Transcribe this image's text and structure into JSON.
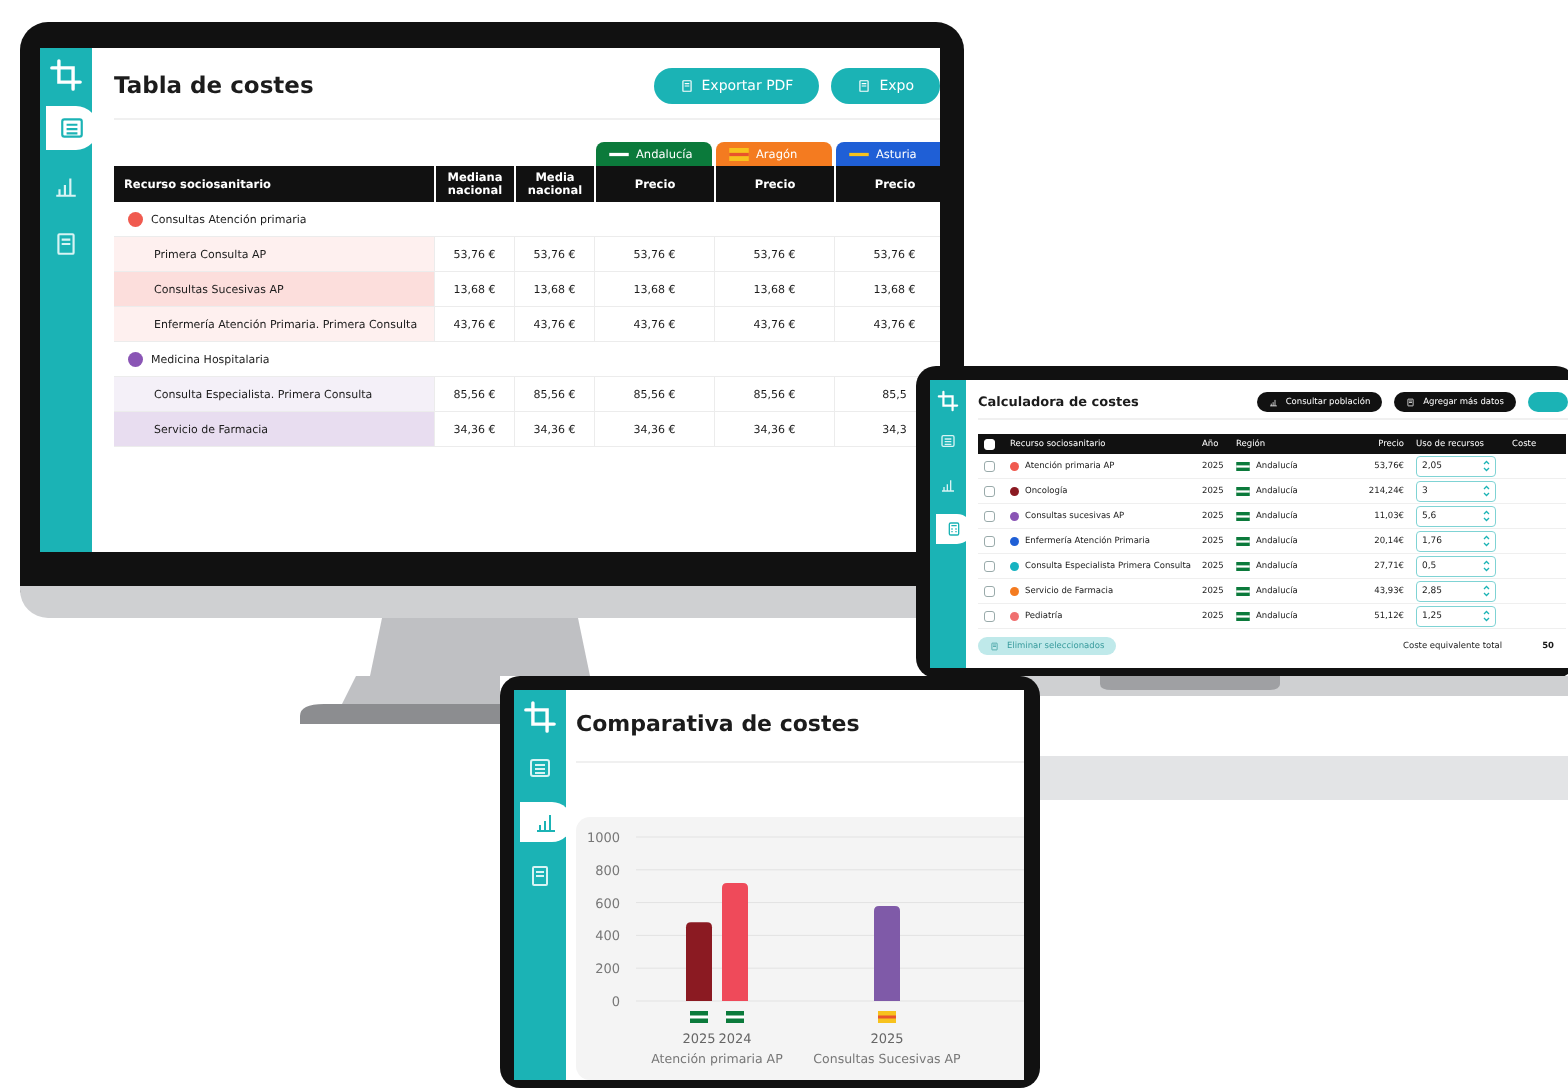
{
  "monitor": {
    "sidebar": [
      {
        "kind": "table",
        "selected": true
      },
      {
        "kind": "chart",
        "selected": false
      },
      {
        "kind": "document",
        "selected": false
      }
    ],
    "title": "Tabla de costes",
    "buttons": [
      "Exportar PDF",
      "Expo"
    ],
    "table": {
      "columns": [
        "Recurso sociosanitario",
        "Mediana nacional",
        "Media nacional"
      ],
      "regions": [
        {
          "name": "Andalucía",
          "color": "#0b7a3b",
          "kind": "andalucia",
          "column": "Precio"
        },
        {
          "name": "Aragón",
          "color": "#f47b20",
          "kind": "aragon",
          "column": "Precio"
        },
        {
          "name": "Asturia",
          "color": "#1f5fd6",
          "kind": "asturias",
          "column": "Precio"
        }
      ],
      "groups": [
        {
          "name": "Consultas Atención primaria",
          "color": "#f05a4f",
          "rows": [
            {
              "name": "Primera Consulta AP",
              "highlighted": false,
              "values": [
                "53,76 €",
                "53,76 €",
                "53,76 €",
                "53,76 €",
                "53,76 €"
              ]
            },
            {
              "name": "Consultas Sucesivas AP",
              "highlighted": true,
              "values": [
                "13,68 €",
                "13,68 €",
                "13,68 €",
                "13,68 €",
                "13,68 €"
              ]
            },
            {
              "name": "Enfermería Atención Primaria. Primera Consulta",
              "highlighted": false,
              "values": [
                "43,76 €",
                "43,76 €",
                "43,76 €",
                "43,76 €",
                "43,76 €"
              ]
            }
          ]
        },
        {
          "name": "Medicina Hospitalaria",
          "color": "#8a55b5",
          "rows": [
            {
              "name": "Consulta Especialista. Primera Consulta",
              "highlighted": false,
              "values": [
                "85,56 €",
                "85,56 €",
                "85,56 €",
                "85,56 €",
                "85,5"
              ]
            },
            {
              "name": "Servicio de Farmacia",
              "highlighted": true,
              "values": [
                "34,36 €",
                "34,36 €",
                "34,36 €",
                "34,36 €",
                "34,3"
              ]
            }
          ]
        }
      ]
    }
  },
  "laptop": {
    "sidebar": [
      {
        "kind": "table",
        "selected": false
      },
      {
        "kind": "chart",
        "selected": false
      },
      {
        "kind": "calculator",
        "selected": true
      }
    ],
    "title": "Calculadora de costes",
    "buttons": [
      "Consultar población",
      "Agregar más datos"
    ],
    "table": {
      "all_checked": false,
      "columns": [
        "Recurso sociosanitario",
        "Año",
        "Región",
        "Precio",
        "Uso de recursos",
        "Coste"
      ],
      "rows": [
        {
          "checked": false,
          "color": "#f05a4f",
          "name": "Atención primaria AP",
          "year": "2025",
          "region": "Andalucía",
          "price": "53,76€",
          "use": "2,05"
        },
        {
          "checked": false,
          "color": "#8b1a22",
          "name": "Oncología",
          "year": "2025",
          "region": "Andalucía",
          "price": "214,24€",
          "use": "3"
        },
        {
          "checked": false,
          "color": "#8a55b5",
          "name": "Consultas sucesivas AP",
          "year": "2025",
          "region": "Andalucía",
          "price": "11,03€",
          "use": "5,6"
        },
        {
          "checked": false,
          "color": "#1f5fd6",
          "name": "Enfermería Atención Primaria",
          "year": "2025",
          "region": "Andalucía",
          "price": "20,14€",
          "use": "1,76"
        },
        {
          "checked": false,
          "color": "#17b3c1",
          "name": "Consulta Especialista Primera Consulta",
          "year": "2025",
          "region": "Andalucía",
          "price": "27,71€",
          "use": "0,5"
        },
        {
          "checked": false,
          "color": "#f47b20",
          "name": "Servicio de Farmacia",
          "year": "2025",
          "region": "Andalucía",
          "price": "43,93€",
          "use": "2,85"
        },
        {
          "checked": false,
          "color": "#f07070",
          "name": "Pediatría",
          "year": "2025",
          "region": "Andalucía",
          "price": "51,12€",
          "use": "1,25"
        }
      ]
    },
    "delete_button": "Eliminar seleccionados",
    "total_label": "Coste equivalente total",
    "total_value": "50"
  },
  "tablet": {
    "sidebar": [
      {
        "kind": "table",
        "selected": false
      },
      {
        "kind": "chart",
        "selected": true
      },
      {
        "kind": "document",
        "selected": false
      }
    ],
    "title": "Comparativa de costes",
    "chart_data": {
      "type": "bar",
      "categories": [
        "Atención primaria AP",
        "Consultas Sucesivas AP"
      ],
      "series": [
        {
          "name": "2025",
          "color": "#8b1a22",
          "values": [
            480,
            null
          ]
        },
        {
          "name": "2024",
          "color": "#ef4a5a",
          "values": [
            720,
            null
          ]
        },
        {
          "name": "2025",
          "color": "#7f5aa8",
          "values": [
            null,
            580
          ]
        }
      ],
      "ylim": [
        0,
        1000
      ],
      "yticks": [
        0,
        200,
        400,
        600,
        800,
        1000
      ],
      "grid": true
    },
    "bar_flags": [
      {
        "kind": "andalucia"
      },
      {
        "kind": "andalucia"
      },
      {
        "kind": "aragon"
      }
    ]
  }
}
